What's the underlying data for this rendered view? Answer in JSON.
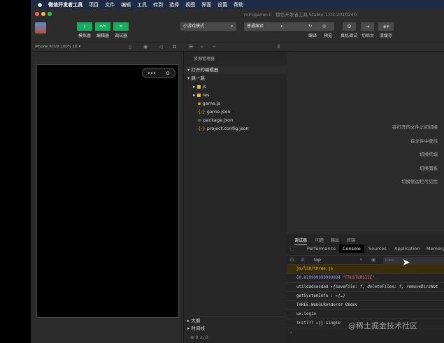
{
  "menubar": {
    "items": [
      "微信开发者工具",
      "项目",
      "文件",
      "编辑",
      "工具",
      "转到",
      "选择",
      "视图",
      "界面",
      "设置",
      "帮助"
    ]
  },
  "window": {
    "title": "minigame-1 - 微信开发者工具 Stable 1.03.2010240"
  },
  "toolbar": {
    "simulator": "模拟器",
    "editor": "编辑器",
    "debugger": "调试器",
    "mode": "小游戏模式",
    "compile_mode": "普通编译",
    "compile": "编译",
    "preview": "预览",
    "remote_debug": "真机调试",
    "background": "切后台",
    "clear_cache": "清缓存"
  },
  "subbar": {
    "device": "iPhone 6/7/8 100% 16 ▾"
  },
  "explorer": {
    "title": "资源管理器",
    "open_editors": "打开的编辑器",
    "project": "跳一跳",
    "files": [
      {
        "name": "js",
        "type": "folder"
      },
      {
        "name": "res",
        "type": "folder"
      },
      {
        "name": "game.js",
        "type": "js"
      },
      {
        "name": "game.json",
        "type": "json"
      },
      {
        "name": "package.json",
        "type": "pkg"
      },
      {
        "name": "project.config.json",
        "type": "json"
      }
    ],
    "outline": "大纲",
    "timeline": "时间线",
    "errors": "0",
    "warnings": "0"
  },
  "editor": {
    "hints": [
      "在打开的文件之间切换",
      "在文件中查找",
      "切换终端",
      "切换面板",
      "切换侧边栏可见性"
    ]
  },
  "debug": {
    "tabs": [
      "调试器",
      "问题",
      "输出",
      "终端"
    ],
    "devtabs": [
      "Performance",
      "Console",
      "Sources",
      "Application",
      "Memory"
    ],
    "context": "top",
    "filter_placeholder": "Filter",
    "lines": [
      "js/lib/three.js",
      "60.029999999999994",
      "\"FRUSTUMSIZE\"",
      "utildadsasdad",
      "▸{saveFile: f, deleteFiles: f, removeDirsNot",
      "getSystemInfo :",
      "▸{…}",
      "THREE.WebGLRenderer 88dev",
      "wx.login",
      "init???",
      "▸{} single"
    ]
  },
  "watermark": "@稀土掘金技术社区",
  "colors": {
    "green": "#1aad5f",
    "warn_bg": "#3a2e0a"
  }
}
